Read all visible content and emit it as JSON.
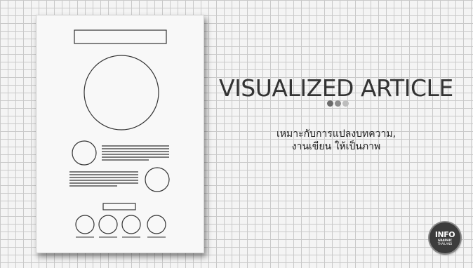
{
  "slide": {
    "title": "VISUALIZED ARTICLE",
    "description_line1": "เหมาะกับการแปลงบทความ,",
    "description_line2": "งานเขียน ให้เป็นภาพ"
  },
  "pager_dots": {
    "colors": [
      "#6a6a6a",
      "#8c8c8c",
      "#bdbdbd"
    ]
  },
  "logo": {
    "line1": "INFO",
    "line2": "GRAPHIC",
    "line3": "THAILAND"
  },
  "colors": {
    "background": "#f4f4f4",
    "grid": "#c9c9c9",
    "paper": "#f8f8f8",
    "ink": "#333333",
    "logo": "#3c3c3c"
  }
}
